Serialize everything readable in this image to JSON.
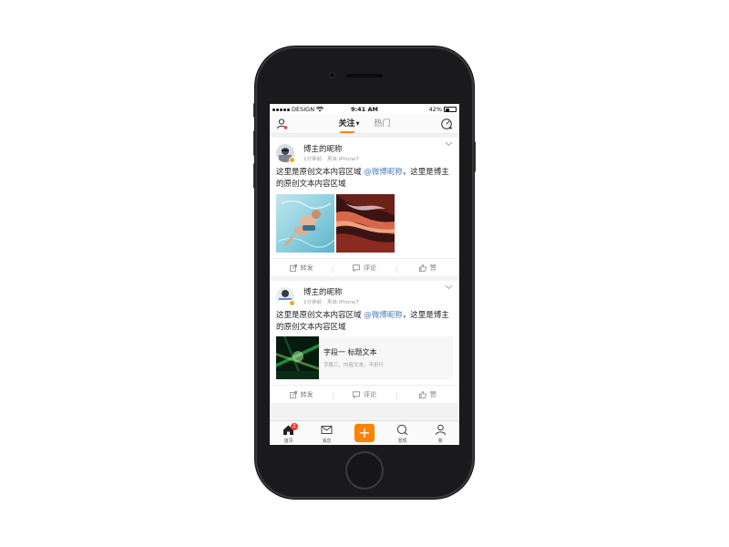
{
  "status_bar": {
    "carrier": "DESIGN",
    "time": "9:41 AM",
    "battery": "42%",
    "battery_level": 0.42
  },
  "nav": {
    "tabs": [
      {
        "label": "关注",
        "active": true
      },
      {
        "label": "热门",
        "active": false
      }
    ],
    "left_icon": "user-icon",
    "right_icon": "radar-icon"
  },
  "posts": [
    {
      "nickname": "博主的昵称",
      "time": "1分钟前",
      "source": "来自 iPhone7",
      "text_before": "这里是原创文本内容区域 ",
      "mention": "@微博昵称",
      "text_after": "，这里是博主的原创文本内容区域",
      "images": [
        "swimmer-photo",
        "canyon-photo"
      ],
      "actions": {
        "repost": "转发",
        "comment": "评论",
        "like": "赞"
      }
    },
    {
      "nickname": "博主的昵称",
      "time": "1分钟前",
      "source": "来自 iPhone7",
      "text_before": "这里是原创文本内容区域 ",
      "mention": "@微博昵称",
      "text_after": "，这里是博主的原创文本内容区域",
      "link_card": {
        "title": "字段一 标题文本",
        "subtitle": "字段三，内容文本，不折行",
        "thumbnail": "concert-lights-photo"
      },
      "actions": {
        "repost": "转发",
        "comment": "评论",
        "like": "赞"
      }
    }
  ],
  "tab_bar": {
    "items": [
      {
        "label": "首页",
        "icon": "home-icon",
        "badge": "2"
      },
      {
        "label": "消息",
        "icon": "mail-icon"
      },
      {
        "label": "",
        "icon": "plus-icon"
      },
      {
        "label": "发现",
        "icon": "search-icon"
      },
      {
        "label": "我",
        "icon": "profile-icon"
      }
    ]
  },
  "colors": {
    "accent": "#ff8200",
    "mention": "#4a7bb5",
    "badge": "#f5402c"
  }
}
